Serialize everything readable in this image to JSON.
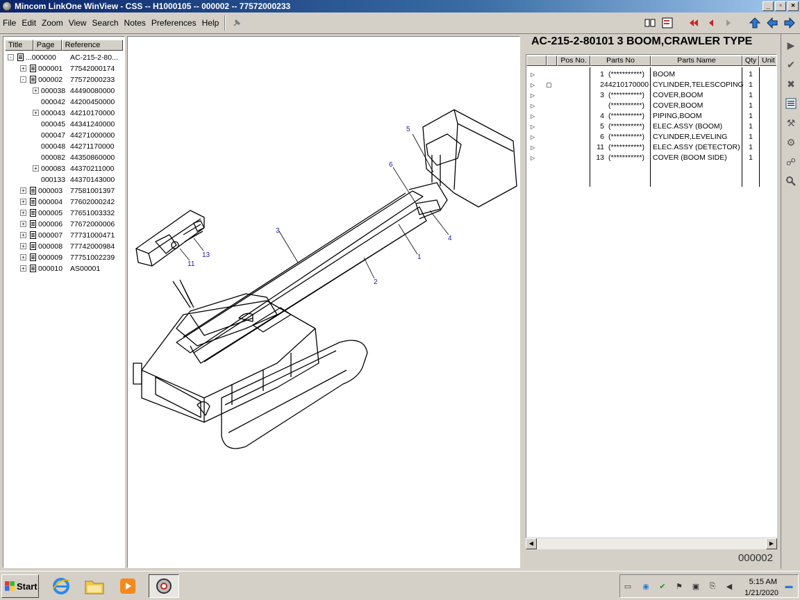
{
  "window": {
    "title": "Mincom LinkOne WinView - CSS -- H1000105 -- 000002 -- 77572000233",
    "controls": [
      "_",
      "▫",
      "×"
    ]
  },
  "menu": [
    "File",
    "Edit",
    "Zoom",
    "View",
    "Search",
    "Notes",
    "Preferences",
    "Help"
  ],
  "tree": {
    "headers": [
      "Title",
      "Page",
      "Reference"
    ],
    "rows": [
      {
        "title": "...000000",
        "ref": "AC-215-2-80...",
        "level": 0,
        "expander": "-"
      },
      {
        "title": "000001",
        "ref": "77542000174",
        "level": 1,
        "expander": "+"
      },
      {
        "title": "000002",
        "ref": "77572000233",
        "level": 1,
        "expander": "-"
      },
      {
        "title": "000038",
        "ref": "44490080000",
        "level": 2,
        "expander": "+"
      },
      {
        "title": "000042",
        "ref": "44200450000",
        "level": 2,
        "expander": ""
      },
      {
        "title": "000043",
        "ref": "44210170000",
        "level": 2,
        "expander": "+"
      },
      {
        "title": "000045",
        "ref": "44341240000",
        "level": 2,
        "expander": ""
      },
      {
        "title": "000047",
        "ref": "44271000000",
        "level": 2,
        "expander": ""
      },
      {
        "title": "000048",
        "ref": "44271170000",
        "level": 2,
        "expander": ""
      },
      {
        "title": "000082",
        "ref": "44350860000",
        "level": 2,
        "expander": ""
      },
      {
        "title": "000083",
        "ref": "44370211000",
        "level": 2,
        "expander": "+"
      },
      {
        "title": "000133",
        "ref": "44370143000",
        "level": 2,
        "expander": ""
      },
      {
        "title": "000003",
        "ref": "77581001397",
        "level": 1,
        "expander": "+"
      },
      {
        "title": "000004",
        "ref": "77602000242",
        "level": 1,
        "expander": "+"
      },
      {
        "title": "000005",
        "ref": "77651003332",
        "level": 1,
        "expander": "+"
      },
      {
        "title": "000006",
        "ref": "77672000006",
        "level": 1,
        "expander": "+"
      },
      {
        "title": "000007",
        "ref": "77731000471",
        "level": 1,
        "expander": "+"
      },
      {
        "title": "000008",
        "ref": "77742000984",
        "level": 1,
        "expander": "+"
      },
      {
        "title": "000009",
        "ref": "77751002239",
        "level": 1,
        "expander": "+"
      },
      {
        "title": "000010",
        "ref": "AS00001",
        "level": 1,
        "expander": "+"
      }
    ]
  },
  "drawing": {
    "callouts": [
      "1",
      "2",
      "3",
      "4",
      "5",
      "6",
      "11",
      "13"
    ]
  },
  "parts": {
    "title": "AC-215-2-80101 3 BOOM,CRAWLER TYPE",
    "headers": [
      "Pos No.",
      "Parts No",
      "Parts Name",
      "Qty",
      "Unit"
    ],
    "rows": [
      {
        "pos": "1",
        "partno": "(***********)",
        "name": "BOOM",
        "qty": "1",
        "checkbox": false
      },
      {
        "pos": "2",
        "partno": "44210170000",
        "name": "CYLINDER,TELESCOPING",
        "qty": "1",
        "checkbox": true
      },
      {
        "pos": "3",
        "partno": "(***********)",
        "name": "COVER,BOOM",
        "qty": "1",
        "checkbox": false
      },
      {
        "pos": "",
        "partno": "(***********)",
        "name": "COVER,BOOM",
        "qty": "1",
        "checkbox": false
      },
      {
        "pos": "4",
        "partno": "(***********)",
        "name": "PIPING,BOOM",
        "qty": "1",
        "checkbox": false
      },
      {
        "pos": "5",
        "partno": "(***********)",
        "name": "ELEC.ASSY (BOOM)",
        "qty": "1",
        "checkbox": false
      },
      {
        "pos": "6",
        "partno": "(***********)",
        "name": "CYLINDER,LEVELING",
        "qty": "1",
        "checkbox": false
      },
      {
        "pos": "11",
        "partno": "(***********)",
        "name": "ELEC.ASSY (DETECTOR)",
        "qty": "1",
        "checkbox": false
      },
      {
        "pos": "13",
        "partno": "(***********)",
        "name": "COVER (BOOM SIDE)",
        "qty": "1",
        "checkbox": false
      }
    ],
    "page_number": "000002"
  },
  "taskbar": {
    "start_label": "Start",
    "time": "5:15 AM",
    "date": "1/21/2020"
  },
  "colors": {
    "titlebar": "#0a246a",
    "callout": "#1a1aa0",
    "face": "#d4d0c8"
  }
}
